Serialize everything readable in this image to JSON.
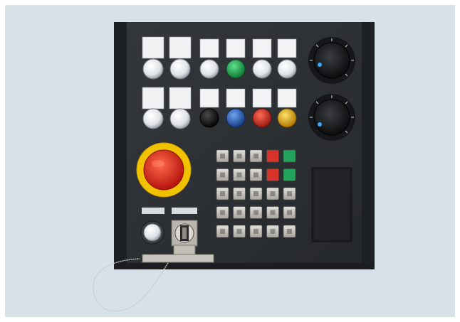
{
  "scene": {
    "subject": "cnc-machine-control-panel",
    "colors": {
      "background": "#d7e1e8",
      "panel": "#2c2f32",
      "panel_edge": "#1e2124",
      "estop_red": "#d92a1f",
      "estop_yellow": "#f2c200",
      "button_green": "#1aa64b",
      "button_blue": "#1f5db8",
      "button_red": "#d42a22",
      "button_yellow": "#f0b400",
      "button_white": "#e8ebee",
      "button_black": "#0f0f10",
      "key_grey": "#c9c7c1",
      "key_red": "#d6332b",
      "key_green": "#20a35a"
    },
    "top_buttons_row1": [
      "white",
      "white",
      "white",
      "green",
      "white",
      "white"
    ],
    "top_buttons_row2": [
      "white",
      "white",
      "black",
      "blue",
      "red",
      "yellow"
    ],
    "keypad_rows": [
      [
        "grey",
        "grey",
        "grey",
        "red",
        "green"
      ],
      [
        "grey",
        "grey",
        "grey",
        "red",
        "green"
      ],
      [
        "grey",
        "grey",
        "grey",
        "grey",
        "grey"
      ],
      [
        "grey",
        "grey",
        "grey",
        "grey",
        "grey"
      ],
      [
        "grey",
        "grey",
        "grey",
        "grey",
        "grey"
      ]
    ],
    "icons": [
      "emergency-stop-icon",
      "rotary-knob-icon",
      "key-switch-icon",
      "cable-icon"
    ]
  }
}
